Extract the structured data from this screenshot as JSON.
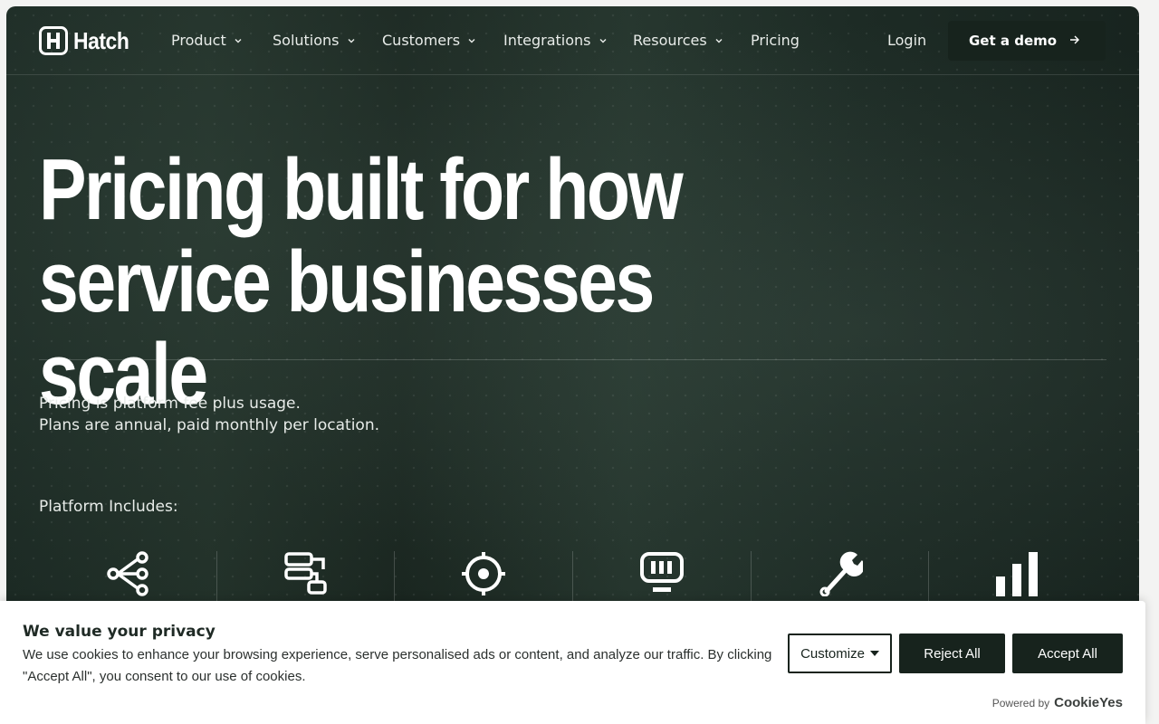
{
  "nav": {
    "logo_text": "Hatch",
    "items": [
      {
        "label": "Product",
        "has_dropdown": true
      },
      {
        "label": "Solutions",
        "has_dropdown": true
      },
      {
        "label": "Customers",
        "has_dropdown": true
      },
      {
        "label": "Integrations",
        "has_dropdown": true
      },
      {
        "label": "Resources",
        "has_dropdown": true
      },
      {
        "label": "Pricing",
        "has_dropdown": false
      }
    ],
    "login_label": "Login",
    "demo_label": "Get a demo"
  },
  "hero": {
    "title_line1": "Pricing built for how",
    "title_line2": "service businesses scale",
    "desc_line1": "Pricing is platform fee plus usage.",
    "desc_line2": "Plans are annual, paid monthly per location."
  },
  "platform": {
    "heading": "Platform Includes:",
    "feature_icons": [
      "share-nodes-icon",
      "workflow-icon",
      "target-icon",
      "monitor-icon",
      "wrench-icon",
      "bar-chart-icon"
    ]
  },
  "cookie_banner": {
    "title": "We value your privacy",
    "text": "We use cookies to enhance your browsing experience, serve personalised ads or content, and analyze our traffic. By clicking \"Accept All\", you consent to our use of cookies.",
    "customize_label": "Customize",
    "reject_label": "Reject All",
    "accept_label": "Accept All",
    "powered_label": "Powered by",
    "powered_brand": "CookieYes"
  },
  "colors": {
    "hero_bg": "#1f2e27",
    "button_dark": "#17231d",
    "text_light": "#e8ece9"
  }
}
